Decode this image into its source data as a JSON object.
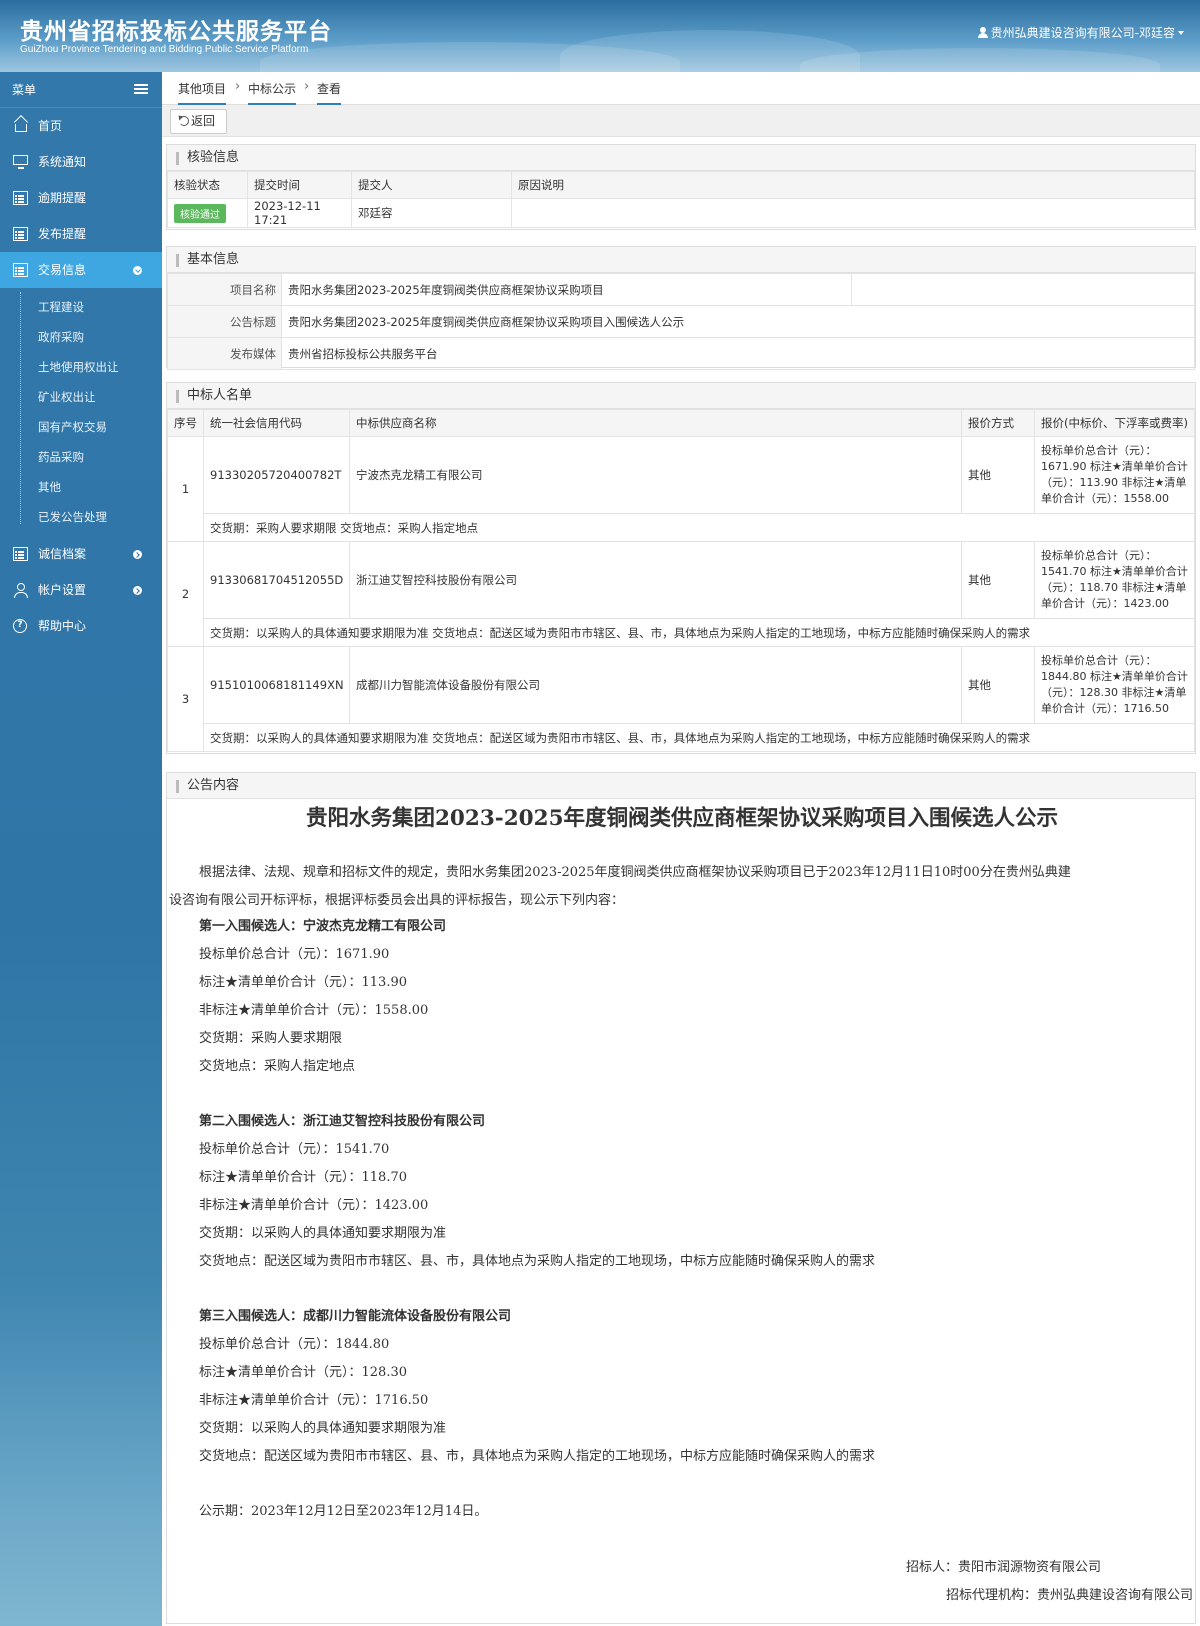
{
  "header": {
    "title": "贵州省招标投标公共服务平台",
    "subtitle": "GuiZhou Province Tendering and Bidding Public Service Platform",
    "user": "贵州弘典建设咨询有限公司-邓廷容"
  },
  "sidebar": {
    "menu_label": "菜单",
    "items": [
      {
        "label": "首页",
        "icon": "home-icon"
      },
      {
        "label": "系统通知",
        "icon": "monitor-icon"
      },
      {
        "label": "逾期提醒",
        "icon": "list-icon"
      },
      {
        "label": "发布提醒",
        "icon": "list-icon"
      },
      {
        "label": "交易信息",
        "icon": "list-icon"
      }
    ],
    "sub_items": [
      "工程建设",
      "政府采购",
      "土地使用权出让",
      "矿业权出让",
      "国有产权交易",
      "药品采购",
      "其他",
      "已发公告处理"
    ],
    "bottom_items": [
      {
        "label": "诚信档案",
        "icon": "list-icon"
      },
      {
        "label": "帐户设置",
        "icon": "person-icon"
      },
      {
        "label": "帮助中心",
        "icon": "help-icon"
      }
    ]
  },
  "breadcrumb": [
    "其他项目",
    "中标公示",
    "查看"
  ],
  "toolbar": {
    "back_label": "返回"
  },
  "verification": {
    "title": "核验信息",
    "headers": [
      "核验状态",
      "提交时间",
      "提交人",
      "原因说明"
    ],
    "status": "核验通过",
    "time": "2023-12-11 17:21",
    "submitter": "邓廷容",
    "reason": ""
  },
  "basic": {
    "title": "基本信息",
    "rows": [
      {
        "label": "项目名称",
        "value": "贵阳水务集团2023-2025年度铜阀类供应商框架协议采购项目"
      },
      {
        "label": "公告标题",
        "value": "贵阳水务集团2023-2025年度铜阀类供应商框架协议采购项目入围候选人公示"
      },
      {
        "label": "发布媒体",
        "value": "贵州省招标投标公共服务平台"
      }
    ]
  },
  "winners": {
    "title": "中标人名单",
    "headers": [
      "序号",
      "统一社会信用代码",
      "中标供应商名称",
      "报价方式",
      "报价(中标价、下浮率或费率)"
    ],
    "rows": [
      {
        "no": "1",
        "code": "91330205720400782T",
        "name": "宁波杰克龙精工有限公司",
        "method": "其他",
        "price": "投标单价总合计（元）：1671.90 标注★清单单价合计（元）：113.90 非标注★清单单价合计（元）：1558.00",
        "delivery": "交货期：采购人要求期限 交货地点：采购人指定地点"
      },
      {
        "no": "2",
        "code": "91330681704512055D",
        "name": "浙江迪艾智控科技股份有限公司",
        "method": "其他",
        "price": "投标单价总合计（元）：1541.70 标注★清单单价合计（元）：118.70 非标注★清单单价合计（元）：1423.00",
        "delivery": "交货期：以采购人的具体通知要求期限为准 交货地点：配送区域为贵阳市市辖区、县、市，具体地点为采购人指定的工地现场，中标方应能随时确保采购人的需求"
      },
      {
        "no": "3",
        "code": "9151010068181149XN",
        "name": "成都川力智能流体设备股份有限公司",
        "method": "其他",
        "price": "投标单价总合计（元）：1844.80 标注★清单单价合计（元）：128.30 非标注★清单单价合计（元）：1716.50",
        "delivery": "交货期：以采购人的具体通知要求期限为准 交货地点：配送区域为贵阳市市辖区、县、市，具体地点为采购人指定的工地现场，中标方应能随时确保采购人的需求"
      }
    ]
  },
  "notice": {
    "section_title": "公告内容",
    "title": "贵阳水务集团2023-2025年度铜阀类供应商框架协议采购项目入围候选人公示",
    "intro_line1": "根据法律、法规、规章和招标文件的规定，贵阳水务集团2023-2025年度铜阀类供应商框架协议采购项目已于2023年12月11日10时00分在贵州弘典建",
    "intro_line2": "设咨询有限公司开标评标，根据评标委员会出具的评标报告，现公示下列内容：",
    "candidates": [
      {
        "heading": "第一入围候选人：宁波杰克龙精工有限公司",
        "lines": [
          "投标单价总合计（元）：1671.90",
          "标注★清单单价合计（元）：113.90",
          "非标注★清单单价合计（元）：1558.00",
          "交货期：采购人要求期限",
          "交货地点：采购人指定地点"
        ]
      },
      {
        "heading": "第二入围候选人：浙江迪艾智控科技股份有限公司",
        "lines": [
          "投标单价总合计（元）：1541.70",
          "标注★清单单价合计（元）：118.70",
          "非标注★清单单价合计（元）：1423.00",
          "交货期：以采购人的具体通知要求期限为准",
          "交货地点：配送区域为贵阳市市辖区、县、市，具体地点为采购人指定的工地现场，中标方应能随时确保采购人的需求"
        ]
      },
      {
        "heading": "第三入围候选人：成都川力智能流体设备股份有限公司",
        "lines": [
          "投标单价总合计（元）：1844.80",
          "标注★清单单价合计（元）：128.30",
          "非标注★清单单价合计（元）：1716.50",
          "交货期：以采购人的具体通知要求期限为准",
          "交货地点：配送区域为贵阳市市辖区、县、市，具体地点为采购人指定的工地现场，中标方应能随时确保采购人的需求"
        ]
      }
    ],
    "period": "公示期：2023年12月12日至2023年12月14日。",
    "tenderer": "招标人：贵阳市润源物资有限公司",
    "agent": "招标代理机构：贵州弘典建设咨询有限公司"
  }
}
